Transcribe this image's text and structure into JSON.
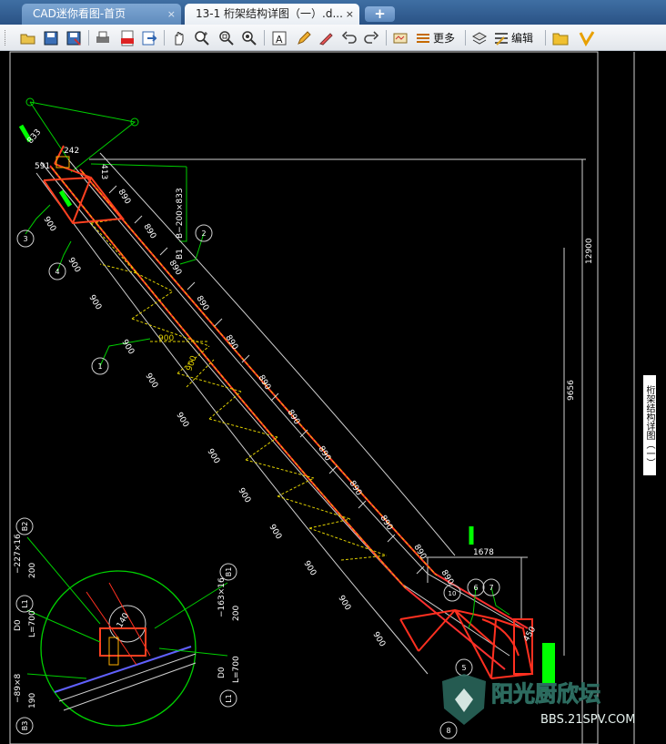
{
  "tabs": [
    {
      "label": "CAD迷你看图-首页",
      "close": "×"
    },
    {
      "label": "13-1 桁架结构详图（一）.d...",
      "close": "×"
    }
  ],
  "new_tab": "+",
  "toolbar": {
    "more_label": "更多",
    "edit_label": "编辑",
    "icons": [
      "open-icon",
      "save-icon",
      "saveas-icon",
      "print-icon",
      "pdf-icon",
      "export-icon",
      "pan-icon",
      "zoom-in-icon",
      "zoom-window-icon",
      "zoom-extents-icon",
      "text-icon",
      "pen-icon",
      "eraser-icon",
      "undo-icon",
      "redo-icon",
      "measure-icon",
      "more-icon",
      "layers-icon",
      "edit-icon",
      "folder-icon",
      "vip-icon"
    ]
  },
  "drawing": {
    "dims_top": [
      "833",
      "242",
      "591",
      "413"
    ],
    "dim_vertical_total": "12900",
    "dim_vertical_part": "9656",
    "dim_horizontal": "1678",
    "member_label": "B1",
    "section_label": "B−200×833",
    "panel_dims": [
      "890",
      "890",
      "890",
      "890",
      "890",
      "890",
      "890",
      "890",
      "890",
      "890",
      "890",
      "890"
    ],
    "bottom_dims": [
      "900",
      "900",
      "900",
      "900",
      "900",
      "900",
      "900",
      "900",
      "900",
      "900",
      "900",
      "900"
    ],
    "inner_dims": [
      "900",
      "900"
    ],
    "section_dim": "450",
    "circle_labels": [
      "1",
      "2",
      "3",
      "4",
      "5",
      "6",
      "7",
      "8",
      "10"
    ],
    "detail_labels": {
      "b2": "B2",
      "b2_text": "−227×16",
      "b2_len": "200",
      "b3": "B3",
      "b3_text": "−89×8",
      "b3_len": "190",
      "l1": "L1",
      "l1_text": "D0",
      "l1_len": "L=700",
      "b1": "B1",
      "b1_text": "−163×16",
      "b1_len": "200",
      "l1b": "L1",
      "l1b_text": "D0",
      "l1b_len": "L=700",
      "circle_dim": "140"
    },
    "side_title": "桁架结构详图（一）",
    "watermark_line1": "阳光厨欣坛",
    "watermark_line2": "BBS.21SPV.COM"
  }
}
